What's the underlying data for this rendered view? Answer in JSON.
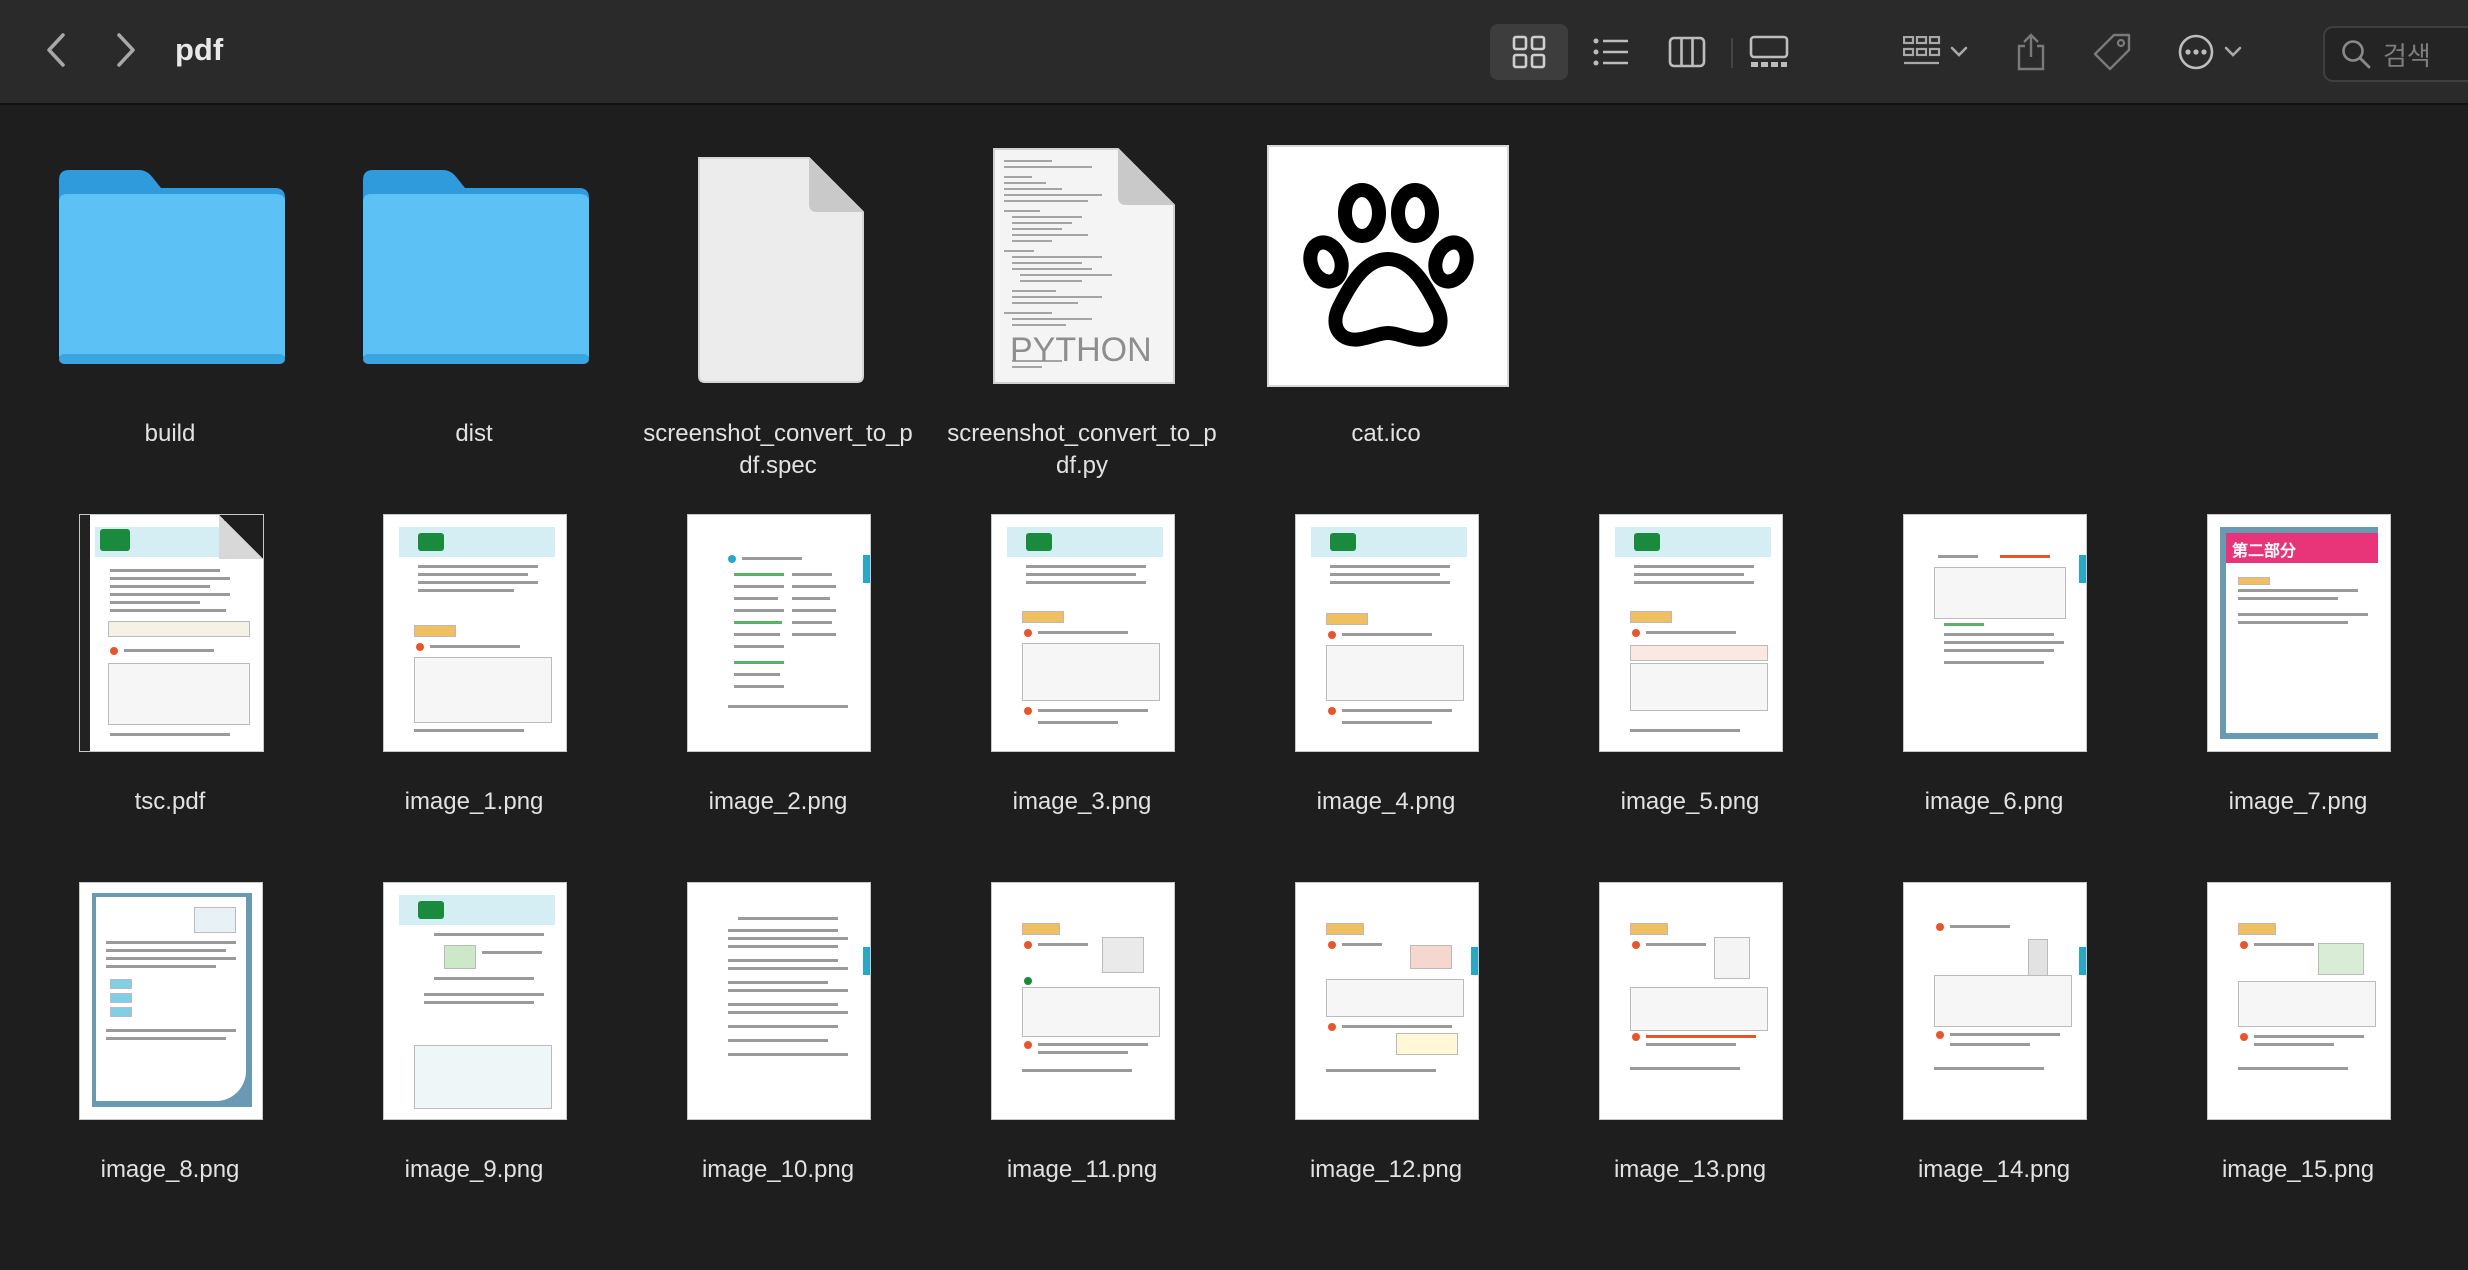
{
  "window": {
    "title": "pdf",
    "search_placeholder": "검색"
  },
  "toolbar": {
    "back_icon": "chevron-left-icon",
    "forward_icon": "chevron-right-icon",
    "views": [
      "icon-view",
      "list-view",
      "column-view",
      "gallery-view"
    ],
    "active_view": "icon-view",
    "tools": [
      "group-icon",
      "share-icon",
      "tag-icon",
      "more-icon"
    ]
  },
  "files": [
    {
      "name": "build",
      "kind": "folder"
    },
    {
      "name": "dist",
      "kind": "folder"
    },
    {
      "name": "screenshot_convert_to_p",
      "name2": "df.spec",
      "kind": "document"
    },
    {
      "name": "screenshot_convert_to_p",
      "name2": "df.py",
      "kind": "python",
      "badge": "PYTHON"
    },
    {
      "name": "cat.ico",
      "kind": "icon-image"
    },
    {
      "name": "tsc.pdf",
      "kind": "pdf"
    },
    {
      "name": "image_1.png",
      "kind": "page",
      "header": "01"
    },
    {
      "name": "image_2.png",
      "kind": "page"
    },
    {
      "name": "image_3.png",
      "kind": "page",
      "header": "02"
    },
    {
      "name": "image_4.png",
      "kind": "page",
      "header": "03"
    },
    {
      "name": "image_5.png",
      "kind": "page",
      "header": "04"
    },
    {
      "name": "image_6.png",
      "kind": "page"
    },
    {
      "name": "image_7.png",
      "kind": "page",
      "header": "第二部分"
    },
    {
      "name": "image_8.png",
      "kind": "page"
    },
    {
      "name": "image_9.png",
      "kind": "page",
      "header": "01"
    },
    {
      "name": "image_10.png",
      "kind": "page"
    },
    {
      "name": "image_11.png",
      "kind": "page"
    },
    {
      "name": "image_12.png",
      "kind": "page"
    },
    {
      "name": "image_13.png",
      "kind": "page"
    },
    {
      "name": "image_14.png",
      "kind": "page"
    },
    {
      "name": "image_15.png",
      "kind": "page"
    }
  ],
  "colors": {
    "folder": "#5ac8fa",
    "background": "#1e1e1e",
    "toolbar": "#2a2a2a",
    "accent_green": "#1a8a3c",
    "accent_pink": "#e8357a"
  }
}
